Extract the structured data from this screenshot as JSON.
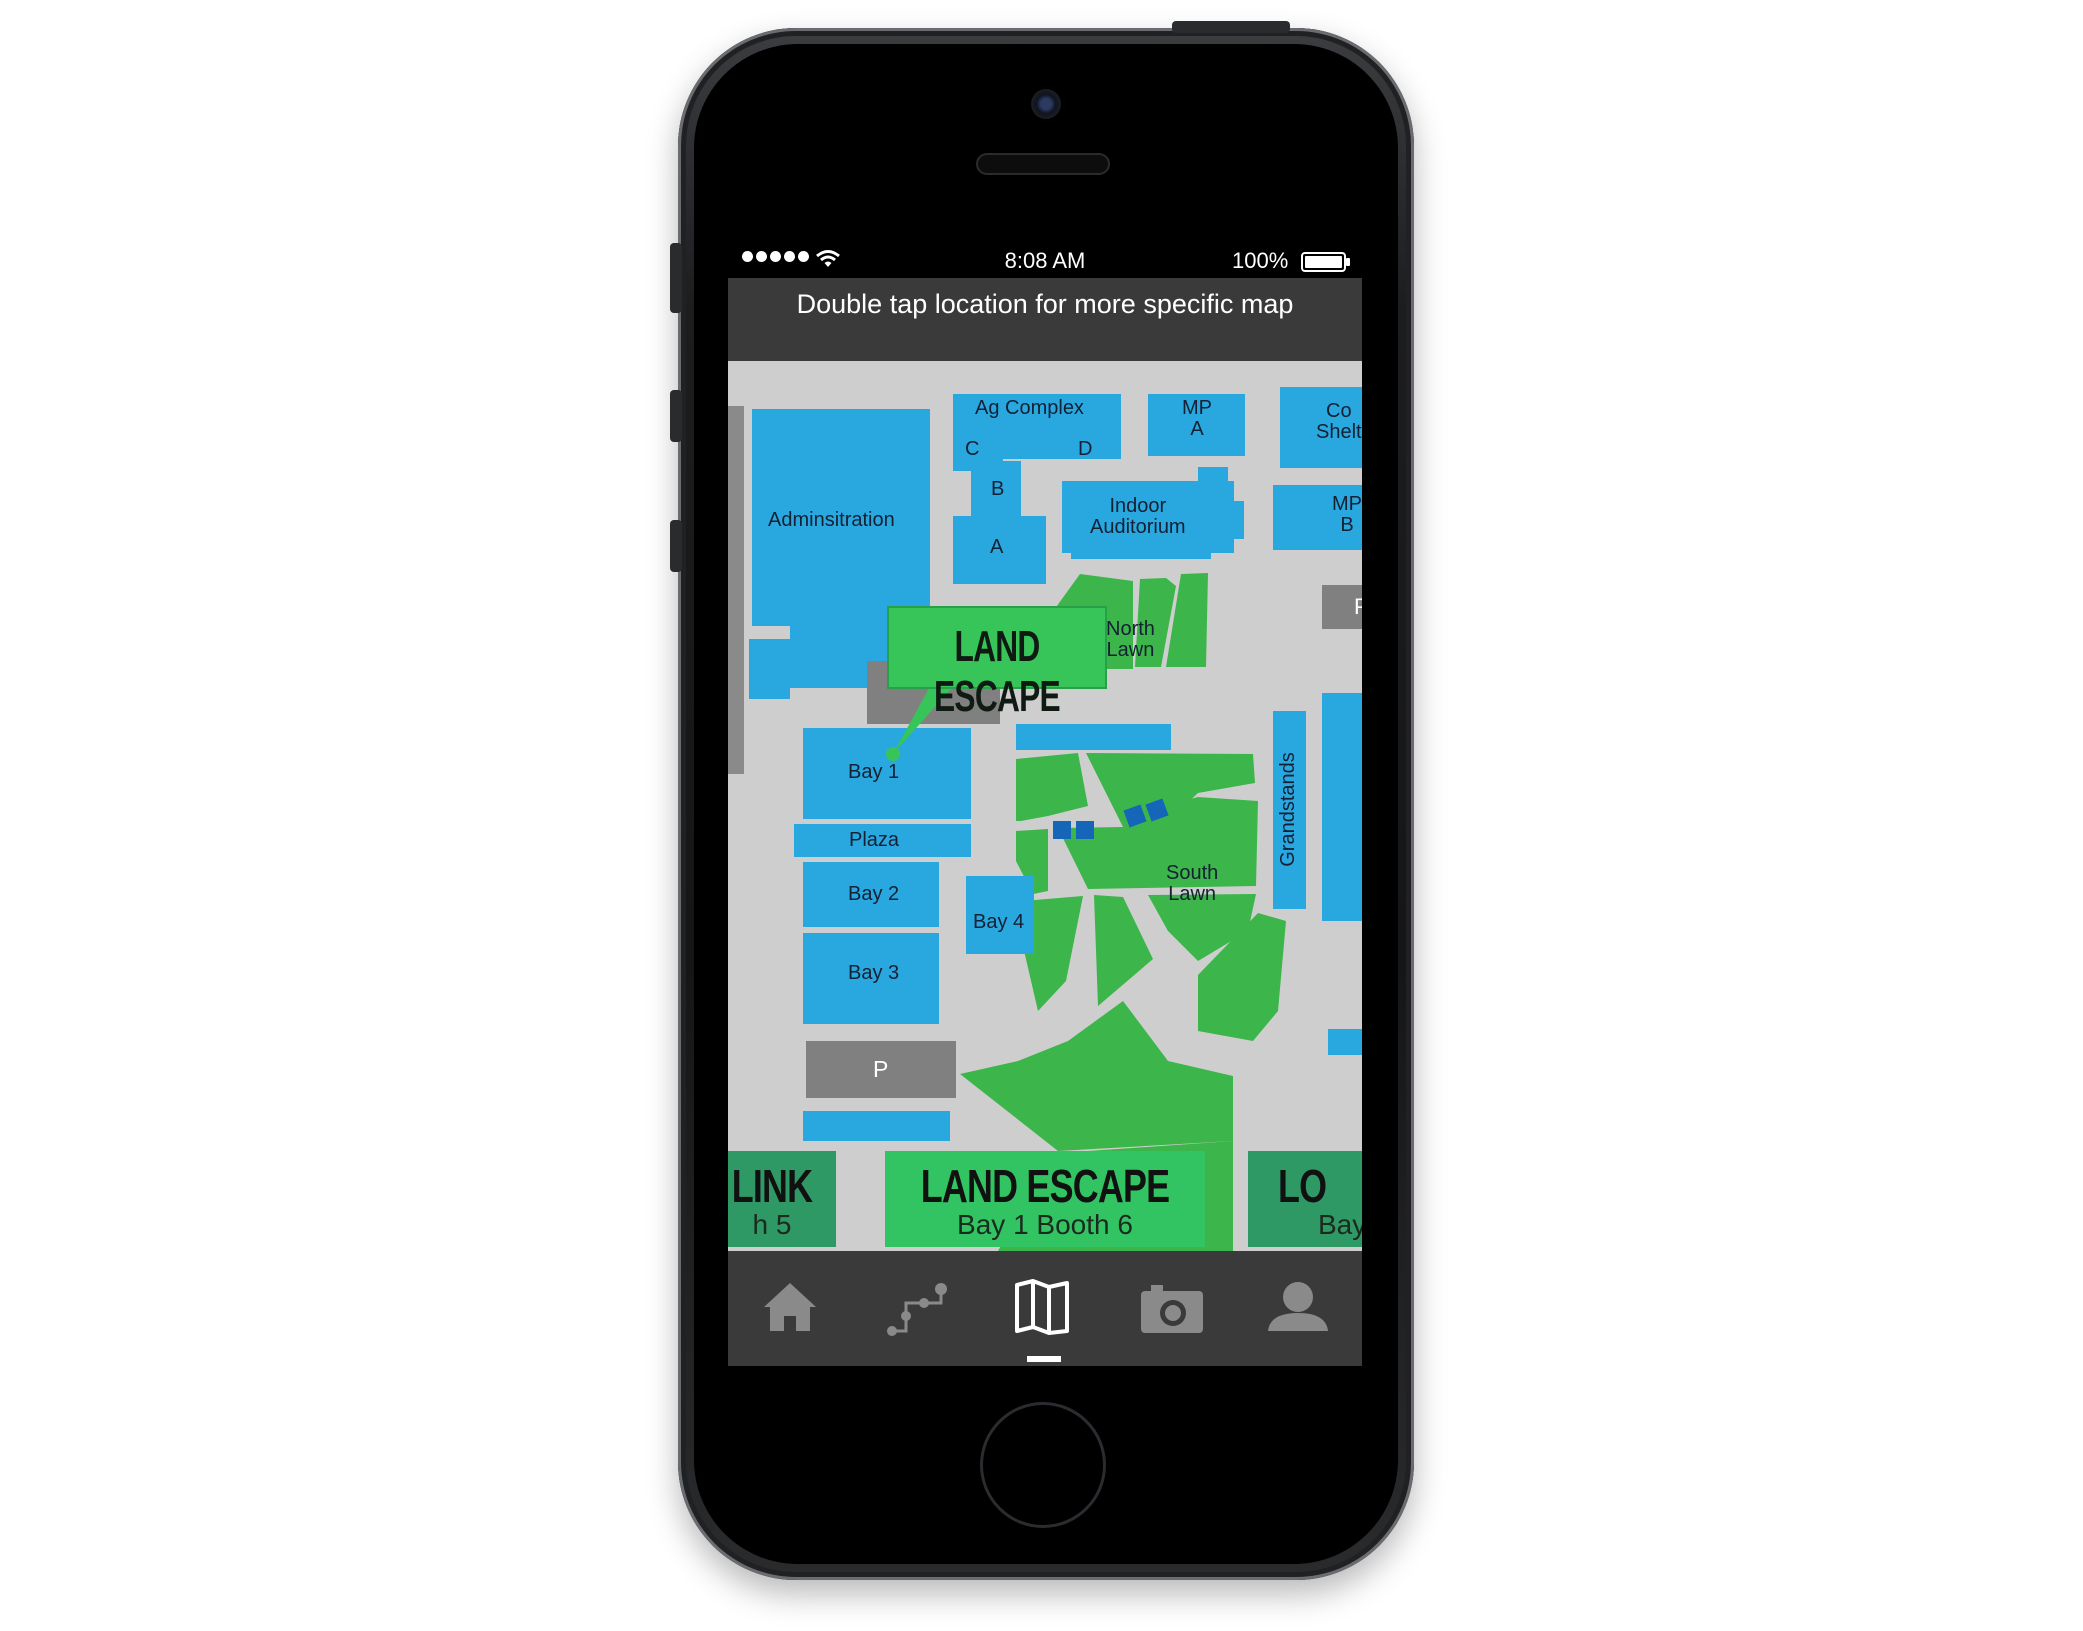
{
  "status_bar": {
    "time": "8:08 AM",
    "battery_percent": "100%",
    "signal_bars": 5,
    "battery_level": 1.0
  },
  "header": {
    "hint": "Double tap location for more specific map"
  },
  "map": {
    "labels": {
      "administration": "Adminsitration",
      "ag_complex": "Ag Complex",
      "ag_c": "C",
      "ag_d": "D",
      "ag_b": "B",
      "ag_a": "A",
      "mp_a": "MP\nA",
      "co_shelter": "Co\nShelt",
      "indoor_auditorium": "Indoor\nAuditorium",
      "mp_b": "MP\nB",
      "parking_right": "P",
      "north_lawn": "North\nLawn",
      "bay1": "Bay 1",
      "plaza": "Plaza",
      "bay2": "Bay 2",
      "bay3": "Bay 3",
      "bay4": "Bay 4",
      "south_lawn": "South\nLawn",
      "grandstands": "Grandstands",
      "parking": "P"
    },
    "callout": {
      "label": "LAND ESCAPE"
    },
    "colors": {
      "building": "#29a8e0",
      "lawn": "#3cb54a",
      "parking": "#808080",
      "ground": "#cecece"
    }
  },
  "cards": [
    {
      "name": "LINK",
      "booth": "h 5"
    },
    {
      "name": "LAND ESCAPE",
      "booth": "Bay 1 Booth 6"
    },
    {
      "name": "LO",
      "booth": "Bay"
    }
  ],
  "tabs": [
    {
      "icon": "home-icon"
    },
    {
      "icon": "route-icon"
    },
    {
      "icon": "map-icon",
      "active": true
    },
    {
      "icon": "camera-icon"
    },
    {
      "icon": "profile-icon"
    }
  ],
  "colors": {
    "accent": "#32c463",
    "bar": "#3a3a3a"
  }
}
